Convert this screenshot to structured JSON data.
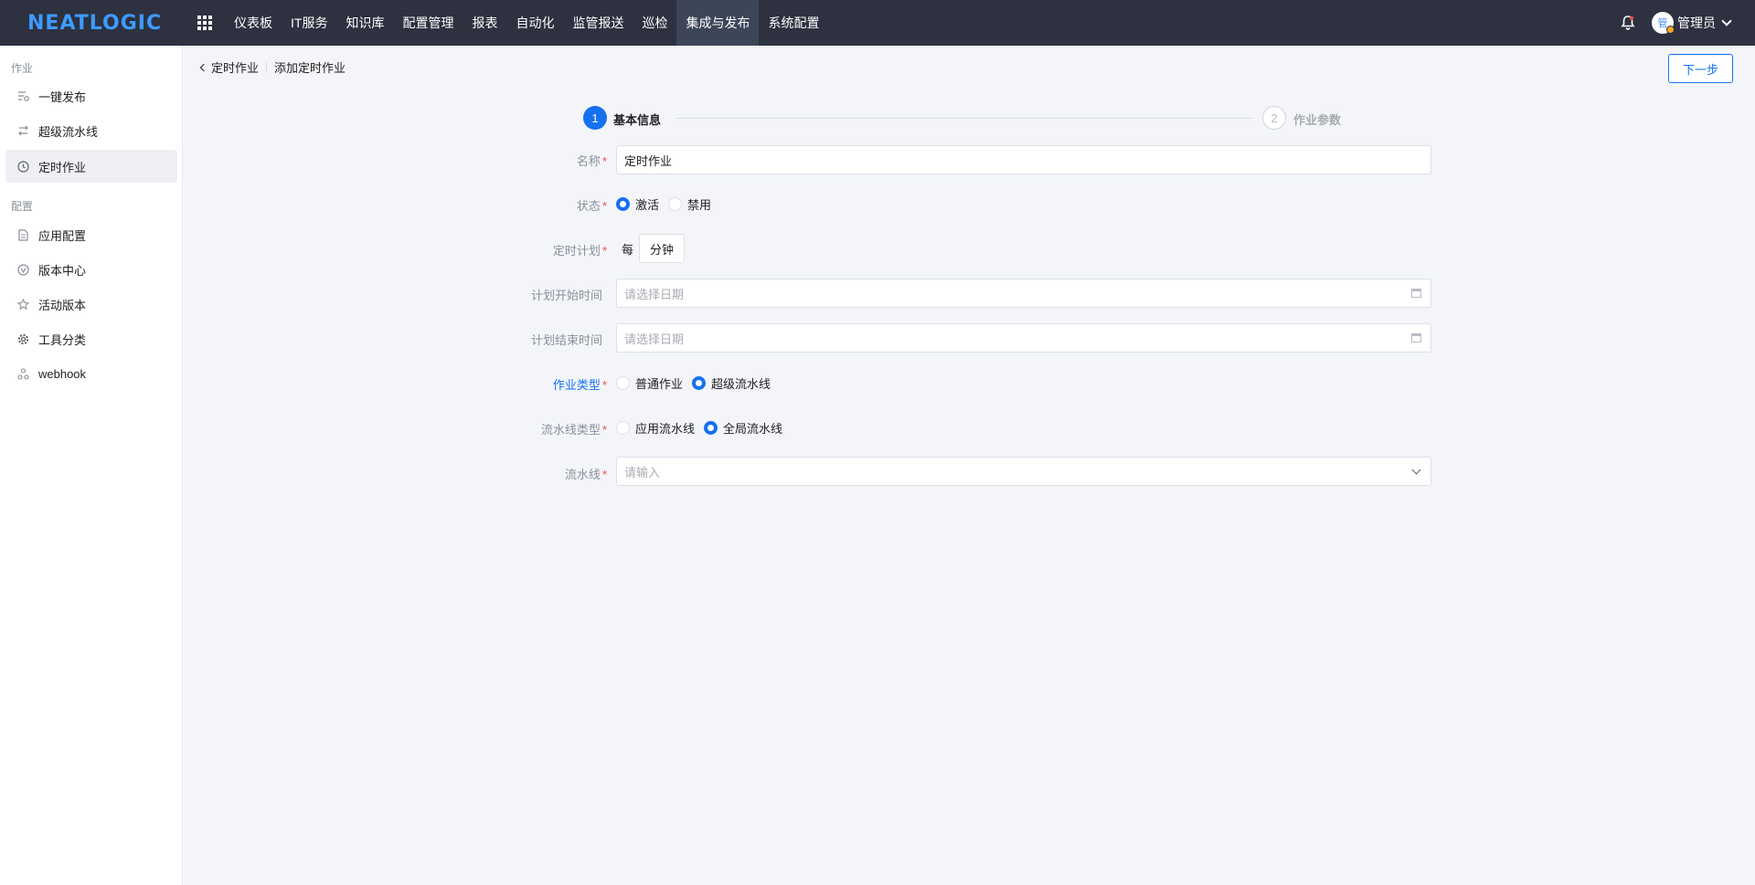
{
  "header": {
    "logo": "NEATLOGIC",
    "nav": [
      {
        "label": "仪表板"
      },
      {
        "label": "IT服务"
      },
      {
        "label": "知识库"
      },
      {
        "label": "配置管理"
      },
      {
        "label": "报表"
      },
      {
        "label": "自动化"
      },
      {
        "label": "监管报送"
      },
      {
        "label": "巡检"
      },
      {
        "label": "集成与发布",
        "active": true
      },
      {
        "label": "系统配置"
      }
    ],
    "user": {
      "avatar_text": "管",
      "name": "管理员"
    }
  },
  "sidebar": {
    "groups": [
      {
        "title": "作业",
        "items": [
          {
            "label": "一键发布",
            "icon": "release-icon"
          },
          {
            "label": "超级流水线",
            "icon": "pipeline-icon"
          },
          {
            "label": "定时作业",
            "icon": "clock-icon",
            "active": true
          }
        ]
      },
      {
        "title": "配置",
        "items": [
          {
            "label": "应用配置",
            "icon": "document-icon"
          },
          {
            "label": "版本中心",
            "icon": "version-icon"
          },
          {
            "label": "活动版本",
            "icon": "star-icon"
          },
          {
            "label": "工具分类",
            "icon": "gear-icon"
          },
          {
            "label": "webhook",
            "icon": "webhook-icon"
          }
        ]
      }
    ]
  },
  "breadcrumb": {
    "back": "定时作业",
    "current": "添加定时作业"
  },
  "toolbar": {
    "next": "下一步"
  },
  "steps": [
    {
      "number": "1",
      "label": "基本信息",
      "active": true
    },
    {
      "number": "2",
      "label": "作业参数",
      "active": false
    }
  ],
  "form": {
    "name": {
      "label": "名称",
      "value": "定时作业"
    },
    "status": {
      "label": "状态",
      "options": [
        "激活",
        "禁用"
      ],
      "selected": "激活"
    },
    "schedule": {
      "label": "定时计划",
      "prefix": "每",
      "unit": "分钟"
    },
    "start_time": {
      "label": "计划开始时间",
      "placeholder": "请选择日期"
    },
    "end_time": {
      "label": "计划结束时间",
      "placeholder": "请选择日期"
    },
    "job_type": {
      "label": "作业类型",
      "options": [
        "普通作业",
        "超级流水线"
      ],
      "selected": "超级流水线"
    },
    "pipeline_type": {
      "label": "流水线类型",
      "options": [
        "应用流水线",
        "全局流水线"
      ],
      "selected": "全局流水线"
    },
    "pipeline": {
      "label": "流水线",
      "placeholder": "请输入"
    }
  },
  "colors": {
    "accent": "#1670f0",
    "topbar": "#2d3140",
    "required": "#f04b4b"
  }
}
